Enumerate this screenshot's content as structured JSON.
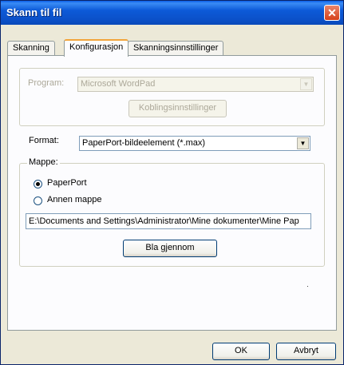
{
  "window": {
    "title": "Skann til fil"
  },
  "tabs": [
    {
      "label": "Skanning"
    },
    {
      "label": "Konfigurasjon"
    },
    {
      "label": "Skanningsinnstillinger"
    }
  ],
  "program": {
    "label": "Program:",
    "value": "Microsoft WordPad",
    "settings_button": "Koblingsinnstillinger"
  },
  "format": {
    "label": "Format:",
    "value": "PaperPort-bildeelement (*.max)"
  },
  "folder": {
    "group_label": "Mappe:",
    "options": [
      {
        "label": "PaperPort",
        "checked": true
      },
      {
        "label": "Annen mappe",
        "checked": false
      }
    ],
    "path": "E:\\Documents and Settings\\Administrator\\Mine dokumenter\\Mine Pap",
    "browse_button": "Bla gjennom"
  },
  "footer": {
    "ok": "OK",
    "cancel": "Avbryt"
  }
}
